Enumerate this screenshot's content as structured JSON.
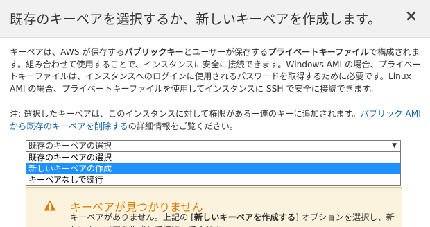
{
  "dialog": {
    "title": "既存のキーペアを選択するか、新しいキーペアを作成します。",
    "close_symbol": "×"
  },
  "description": {
    "p1_a": "キーペアは、AWS が保存する",
    "p1_b": "パブリックキー",
    "p1_c": "とユーザーが保存する",
    "p1_d": "プライベートキーファイル",
    "p1_e": "で構成されます。組み合わせて使用することで、インスタンスに安全に接続できます。Windows AMI の場合、プライベートキーファイルは、インスタンスへのログインに使用されるパスワードを取得するために必要です。Linux AMI の場合、プライベートキーファイルを使用してインスタンスに SSH で安全に接続できます。"
  },
  "note": {
    "prefix": "注: 選択したキーペアは、このインスタンスに対して権限がある一連のキーに追加されます。",
    "link": "パブリック AMI から既存のキーペアを削除する",
    "suffix": "の詳細情報をご覧ください。"
  },
  "keypair_select": {
    "value": "既存のキーペアの選択",
    "arrow": "▼",
    "options": [
      "既存のキーペアの選択",
      "新しいキーペアの作成",
      "キーペアなしで続行"
    ],
    "highlighted_index": 1
  },
  "warning": {
    "icon": "warning-triangle-icon",
    "title": "キーペアが見つかりません",
    "text_a": "キーペアがありません。上記の [",
    "text_b": "新しいキーペアを作成する",
    "text_c": "] オプションを選択し、新しいキーペアを作成して続行してください。"
  },
  "colors": {
    "link": "#1a67a3",
    "highlight": "#1e90ff",
    "warning_title": "#e07b00",
    "warning_bg": "#fbf3dd",
    "warning_border": "#e3c57b"
  }
}
